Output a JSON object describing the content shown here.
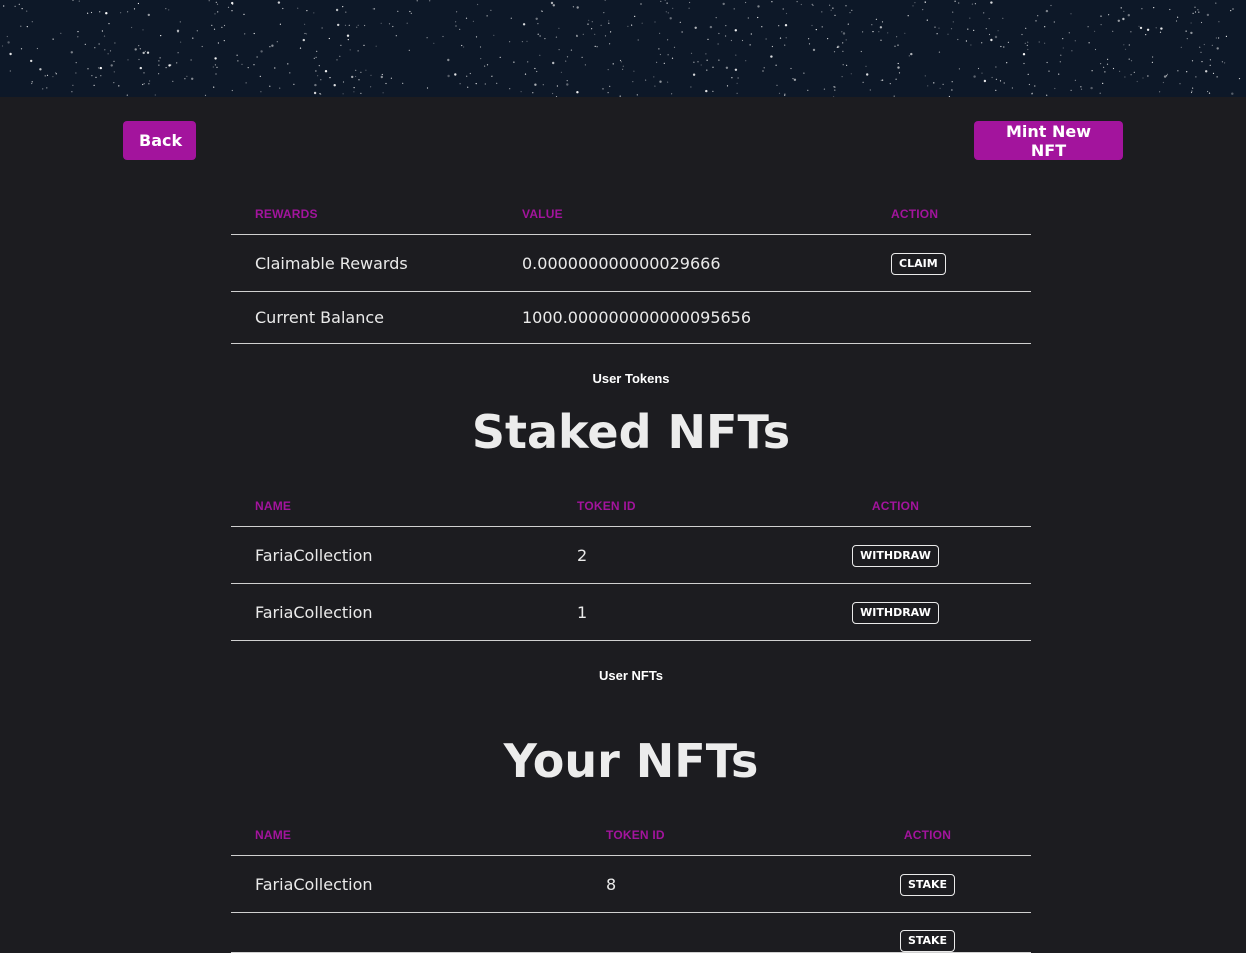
{
  "nav": {
    "back_label": "Back",
    "mint_label": "Mint New NFT"
  },
  "rewards_table": {
    "headers": [
      "REWARDS",
      "VALUE",
      "ACTION"
    ],
    "rows": [
      {
        "label": "Claimable Rewards",
        "value": "0.000000000000029666",
        "action": "CLAIM"
      },
      {
        "label": "Current Balance",
        "value": "1000.000000000000095656"
      }
    ]
  },
  "user_tokens_caption": "User Tokens",
  "staked": {
    "title": "Staked NFTs",
    "headers": [
      "NAME",
      "TOKEN ID",
      "ACTION"
    ],
    "rows": [
      {
        "name": "FariaCollection",
        "token_id": "2",
        "action": "WITHDRAW"
      },
      {
        "name": "FariaCollection",
        "token_id": "1",
        "action": "WITHDRAW"
      }
    ]
  },
  "user_nfts_caption": "User NFTs",
  "your_nfts": {
    "title": "Your NFTs",
    "headers": [
      "NAME",
      "TOKEN ID",
      "ACTION"
    ],
    "rows": [
      {
        "name": "FariaCollection",
        "token_id": "8",
        "action": "STAKE"
      },
      {
        "name": "",
        "token_id": "",
        "action": "STAKE"
      }
    ]
  },
  "colors": {
    "accent": "#a3149d",
    "background": "#1c1c20",
    "banner": "#0d1828"
  }
}
